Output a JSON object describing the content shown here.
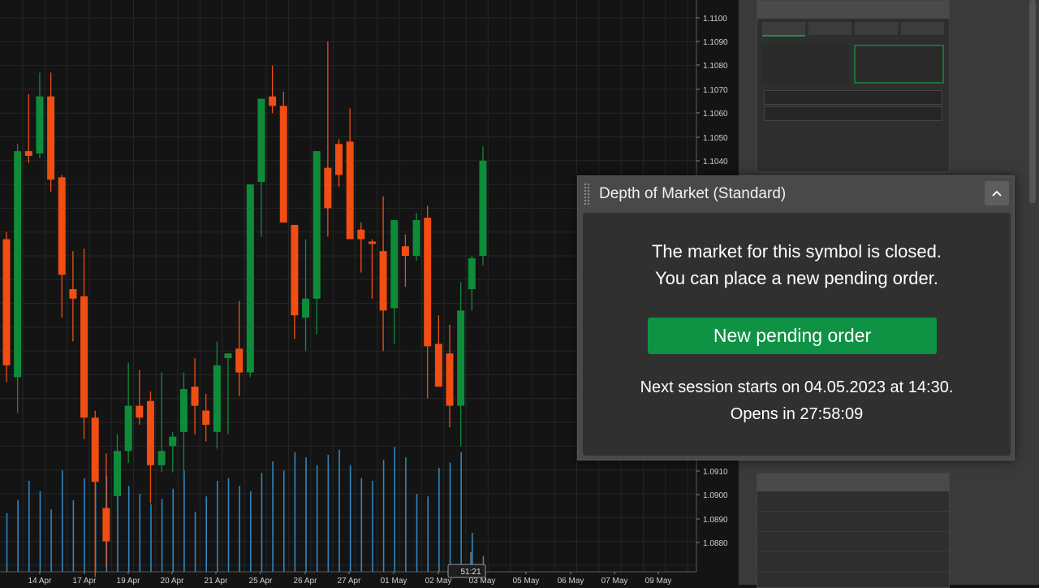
{
  "dom_panel": {
    "title": "Depth of Market (Standard)",
    "message_line1": "The market for this symbol is closed.",
    "message_line2": "You can place a new pending order.",
    "button_label": "New pending order",
    "next_session": "Next session starts on 04.05.2023 at 14:30.",
    "opens_in": "Opens in 27:58:09",
    "collapse_icon": "chevron-up-icon"
  },
  "colors": {
    "bull": "#0e8c3a",
    "bear": "#f04e12",
    "volume": "#2f86c0",
    "button": "#0f9244",
    "background": "#141414",
    "grid": "#262626"
  },
  "chart_data": {
    "type": "candlestick",
    "price_range": [
      1.0874,
      1.1106
    ],
    "price_ticks": [
      "1.1100",
      "1.1090",
      "1.1080",
      "1.1070",
      "1.1060",
      "1.1050",
      "1.1040",
      "1.0910",
      "1.0900",
      "1.0890",
      "1.0880"
    ],
    "x_labels": [
      "14 Apr",
      "17 Apr",
      "19 Apr",
      "20 Apr",
      "21 Apr",
      "25 Apr",
      "26 Apr",
      "27 Apr",
      "01 May",
      "02 May",
      "03 May",
      "05 May",
      "06 May",
      "07 May",
      "09 May"
    ],
    "cursor_label": "51:21",
    "candles": [
      {
        "o": 1.1007,
        "h": 1.101,
        "l": 1.0947,
        "c": 1.0954
      },
      {
        "o": 1.0949,
        "h": 1.1047,
        "l": 1.0934,
        "c": 1.1044
      },
      {
        "o": 1.1044,
        "h": 1.1068,
        "l": 1.1039,
        "c": 1.1042
      },
      {
        "o": 1.1043,
        "h": 1.1077,
        "l": 1.1041,
        "c": 1.1067
      },
      {
        "o": 1.1067,
        "h": 1.1077,
        "l": 1.1027,
        "c": 1.1032
      },
      {
        "o": 1.1033,
        "h": 1.1034,
        "l": 1.0974,
        "c": 1.0992
      },
      {
        "o": 1.0986,
        "h": 1.1002,
        "l": 1.0964,
        "c": 1.0982
      },
      {
        "o": 1.0983,
        "h": 1.1003,
        "l": 1.0923,
        "c": 1.0932
      },
      {
        "o": 1.0932,
        "h": 1.0935,
        "l": 1.0865,
        "c": 1.0905
      },
      {
        "o": 1.0894,
        "h": 1.0917,
        "l": 1.0869,
        "c": 1.088
      },
      {
        "o": 1.0899,
        "h": 1.0925,
        "l": 1.0893,
        "c": 1.0918
      },
      {
        "o": 1.0918,
        "h": 1.0955,
        "l": 1.0913,
        "c": 1.0937
      },
      {
        "o": 1.0937,
        "h": 1.0952,
        "l": 1.0929,
        "c": 1.0932
      },
      {
        "o": 1.0939,
        "h": 1.0943,
        "l": 1.0896,
        "c": 1.0912
      },
      {
        "o": 1.0912,
        "h": 1.0951,
        "l": 1.0909,
        "c": 1.0918
      },
      {
        "o": 1.092,
        "h": 1.0926,
        "l": 1.0909,
        "c": 1.0924
      },
      {
        "o": 1.0926,
        "h": 1.0951,
        "l": 1.0905,
        "c": 1.0944
      },
      {
        "o": 1.0945,
        "h": 1.0957,
        "l": 1.0925,
        "c": 1.0937
      },
      {
        "o": 1.0935,
        "h": 1.0942,
        "l": 1.0922,
        "c": 1.0929
      },
      {
        "o": 1.0926,
        "h": 1.0964,
        "l": 1.0919,
        "c": 1.0954
      },
      {
        "o": 1.0957,
        "h": 1.0959,
        "l": 1.0925,
        "c": 1.0959
      },
      {
        "o": 1.0961,
        "h": 1.0981,
        "l": 1.0941,
        "c": 1.0951
      },
      {
        "o": 1.0951,
        "h": 1.0989,
        "l": 1.0949,
        "c": 1.103
      },
      {
        "o": 1.1031,
        "h": 1.1045,
        "l": 1.1008,
        "c": 1.1066
      },
      {
        "o": 1.1067,
        "h": 1.108,
        "l": 1.106,
        "c": 1.1063
      },
      {
        "o": 1.1063,
        "h": 1.1069,
        "l": 1.1035,
        "c": 1.1014
      },
      {
        "o": 1.1013,
        "h": 1.1001,
        "l": 1.0965,
        "c": 1.0975
      },
      {
        "o": 1.0974,
        "h": 1.1007,
        "l": 1.096,
        "c": 1.0982
      },
      {
        "o": 1.0982,
        "h": 1.1035,
        "l": 1.0967,
        "c": 1.1044
      },
      {
        "o": 1.1037,
        "h": 1.109,
        "l": 1.1008,
        "c": 1.102
      },
      {
        "o": 1.1047,
        "h": 1.1049,
        "l": 1.1029,
        "c": 1.1034
      },
      {
        "o": 1.1048,
        "h": 1.1062,
        "l": 1.1007,
        "c": 1.1007
      },
      {
        "o": 1.1011,
        "h": 1.1014,
        "l": 1.0993,
        "c": 1.1007
      },
      {
        "o": 1.1006,
        "h": 1.1007,
        "l": 1.0982,
        "c": 1.1005
      },
      {
        "o": 1.1002,
        "h": 1.1025,
        "l": 1.096,
        "c": 1.0977
      },
      {
        "o": 1.0978,
        "h": 1.0992,
        "l": 1.0963,
        "c": 1.1015
      },
      {
        "o": 1.1004,
        "h": 1.1009,
        "l": 1.0987,
        "c": 1.1
      },
      {
        "o": 1.1,
        "h": 1.1018,
        "l": 1.0998,
        "c": 1.1015
      },
      {
        "o": 1.1016,
        "h": 1.1021,
        "l": 1.094,
        "c": 1.0962
      },
      {
        "o": 1.0963,
        "h": 1.0975,
        "l": 1.095,
        "c": 1.0945
      },
      {
        "o": 1.0959,
        "h": 1.0971,
        "l": 1.0928,
        "c": 1.0937
      },
      {
        "o": 1.0937,
        "h": 1.0989,
        "l": 1.092,
        "c": 1.0977
      },
      {
        "o": 1.0986,
        "h": 1.1,
        "l": 1.0977,
        "c": 1.0999
      },
      {
        "o": 1.1,
        "h": 1.1046,
        "l": 1.0996,
        "c": 1.104
      }
    ],
    "volumes": [
      0.45,
      0.55,
      0.7,
      0.62,
      0.48,
      0.78,
      0.55,
      0.72,
      0.68,
      0.74,
      0.58,
      0.66,
      0.6,
      0.52,
      0.56,
      0.64,
      0.78,
      0.46,
      0.58,
      0.7,
      0.72,
      0.66,
      0.62,
      0.76,
      0.85,
      0.78,
      0.92,
      0.88,
      0.82,
      0.9,
      0.94,
      0.82,
      0.72,
      0.7,
      0.86,
      0.96,
      0.88,
      0.6,
      0.58,
      0.8,
      0.84,
      0.92,
      0.3,
      0.12
    ],
    "grid": true
  }
}
